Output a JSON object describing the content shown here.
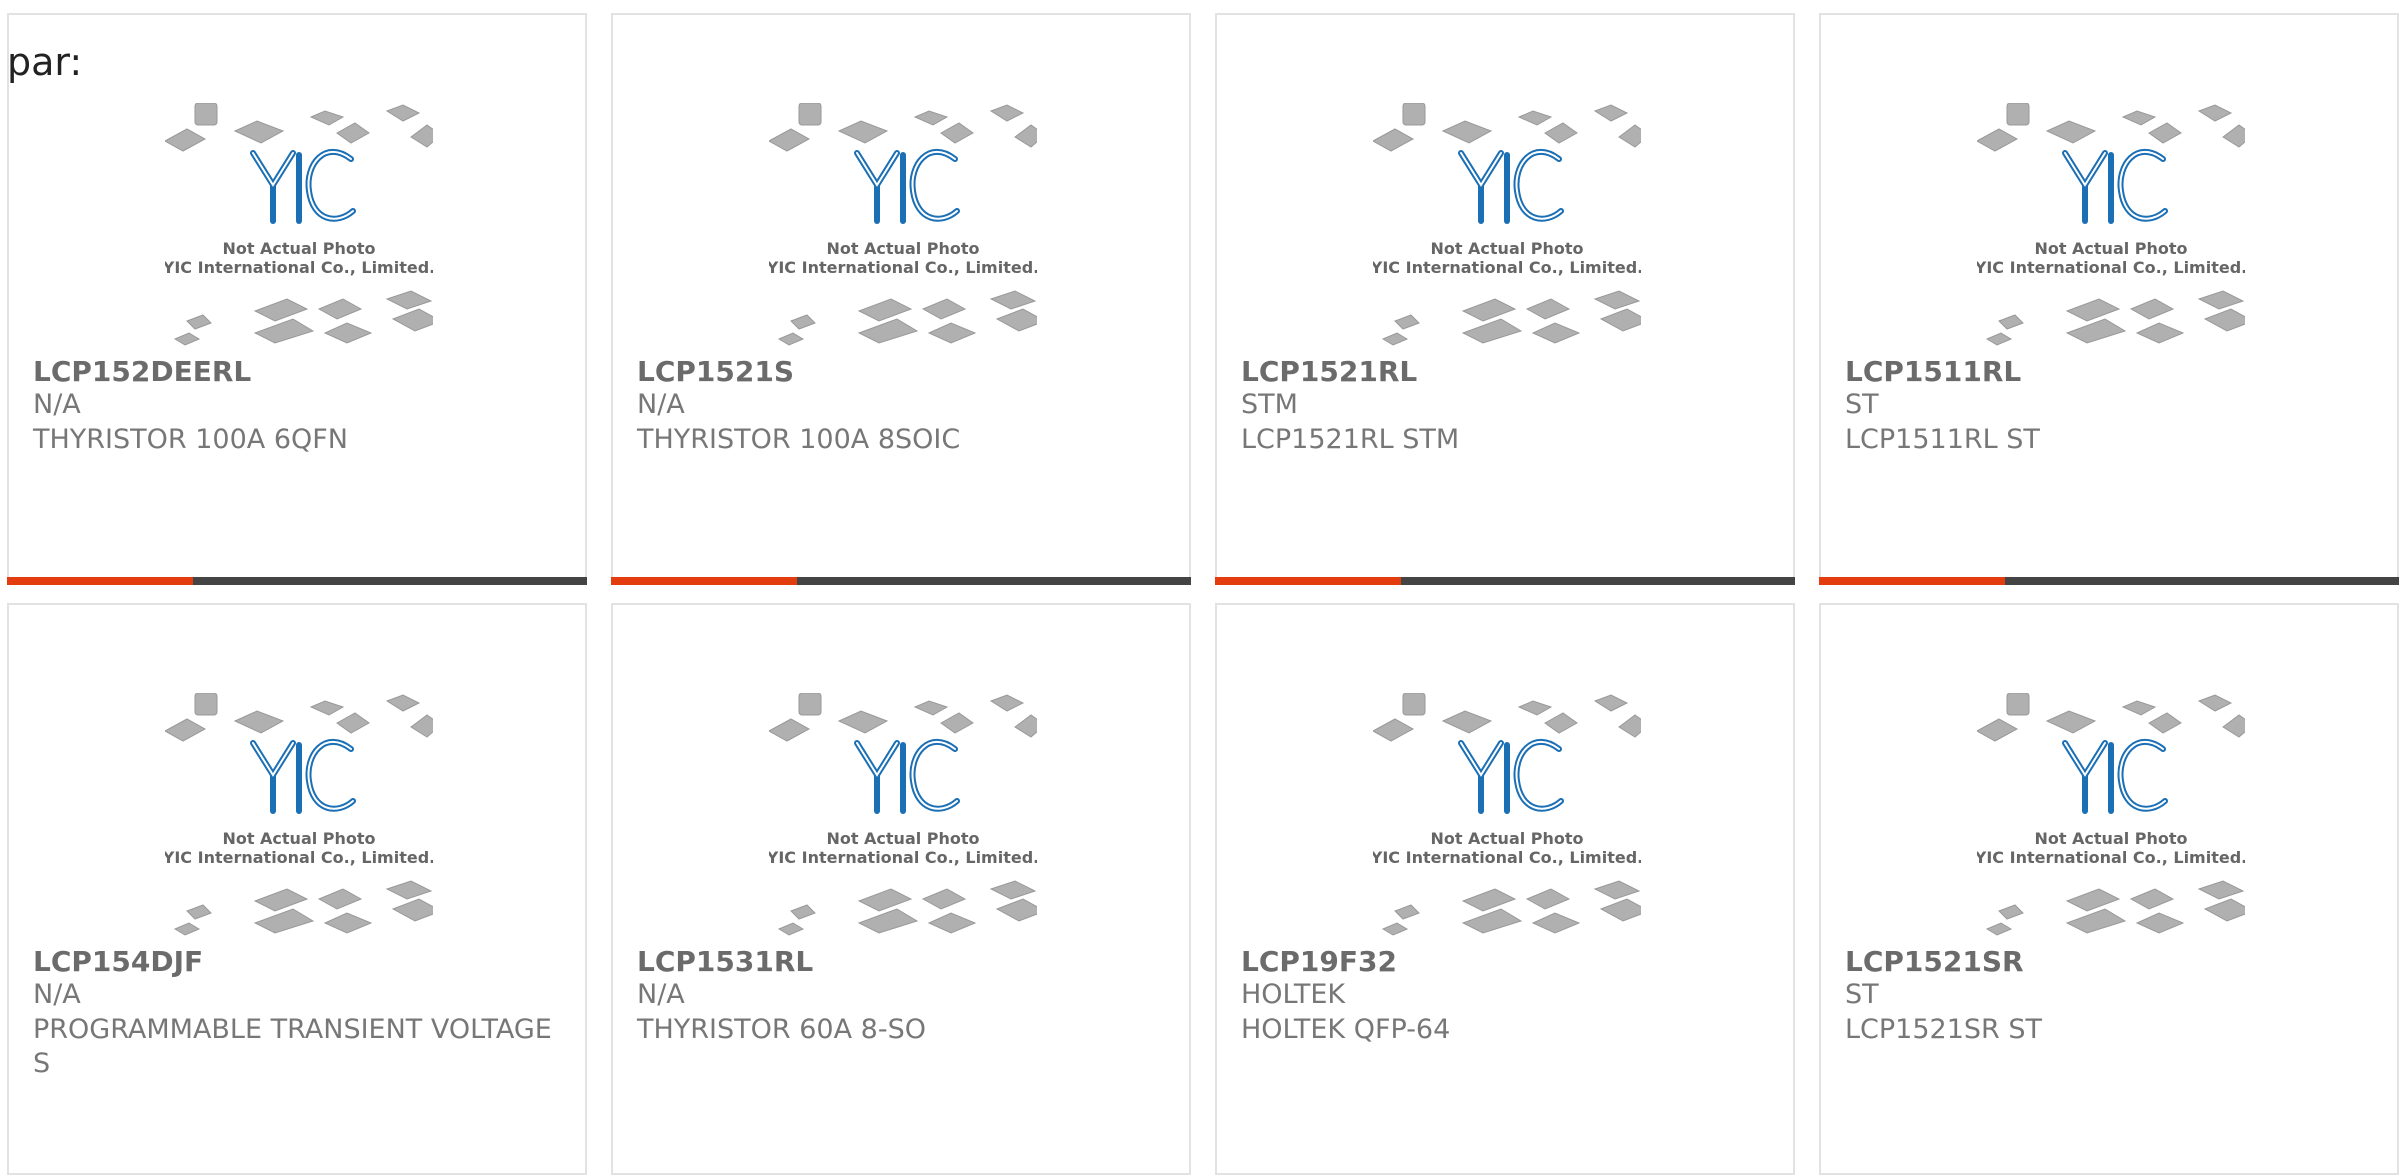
{
  "intro_text": "par:",
  "photo": {
    "caption_line1": "Not Actual Photo",
    "caption_line2": "YIC International Co., Limited.",
    "logo_text": "YIC"
  },
  "accent_color": "#e23c0f",
  "products": [
    {
      "part": "LCP152DEERL",
      "mfr": "N/A",
      "desc": "THYRISTOR 100A 6QFN",
      "has_bar": true
    },
    {
      "part": "LCP1521S",
      "mfr": "N/A",
      "desc": "THYRISTOR 100A 8SOIC",
      "has_bar": true
    },
    {
      "part": "LCP1521RL",
      "mfr": "STM",
      "desc": "LCP1521RL STM",
      "has_bar": true
    },
    {
      "part": "LCP1511RL",
      "mfr": "ST",
      "desc": "LCP1511RL ST",
      "has_bar": true
    },
    {
      "part": "LCP154DJF",
      "mfr": "N/A",
      "desc": "PROGRAMMABLE TRANSIENT VOLTAGE S",
      "has_bar": false
    },
    {
      "part": "LCP1531RL",
      "mfr": "N/A",
      "desc": "THYRISTOR 60A 8-SO",
      "has_bar": false
    },
    {
      "part": "LCP19F32",
      "mfr": "HOLTEK",
      "desc": "HOLTEK QFP-64",
      "has_bar": false
    },
    {
      "part": "LCP1521SR",
      "mfr": "ST",
      "desc": "LCP1521SR ST",
      "has_bar": false
    }
  ]
}
